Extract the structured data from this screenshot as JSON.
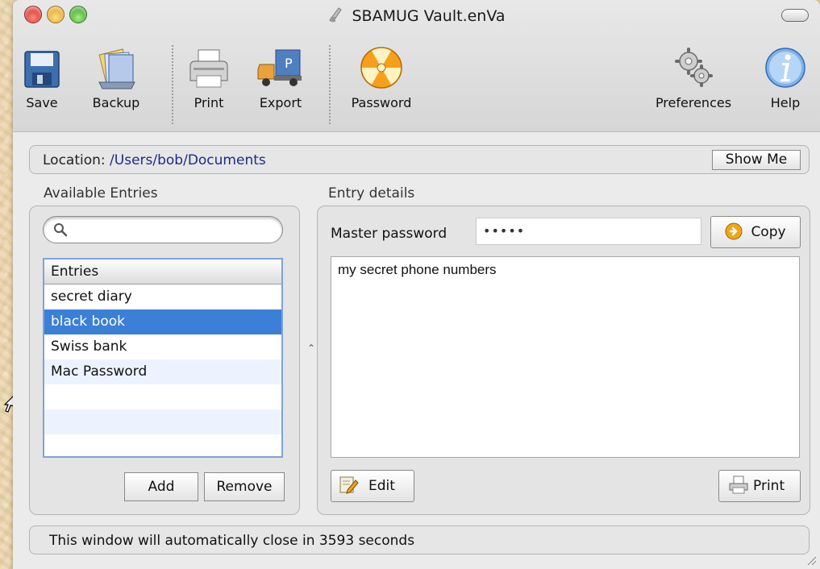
{
  "window": {
    "title": "SBAMUG Vault.enVa"
  },
  "toolbar": {
    "items": [
      {
        "label": "Save",
        "icon": "floppy-disk-icon"
      },
      {
        "label": "Backup",
        "icon": "backup-icon"
      },
      {
        "label": "Print",
        "icon": "printer-icon"
      },
      {
        "label": "Export",
        "icon": "export-truck-icon"
      },
      {
        "label": "Password",
        "icon": "radiation-password-icon"
      },
      {
        "label": "Preferences",
        "icon": "gears-icon"
      },
      {
        "label": "Help",
        "icon": "info-help-icon"
      }
    ]
  },
  "location": {
    "label": "Location:",
    "path": "/Users/bob/Documents",
    "show_me": "Show Me"
  },
  "entries_panel": {
    "title": "Available Entries",
    "search_placeholder": "",
    "column_header": "Entries",
    "entries": [
      "secret diary",
      "black book",
      "Swiss bank",
      "Mac Password"
    ],
    "selected": "black book",
    "add_label": "Add",
    "remove_label": "Remove"
  },
  "details_panel": {
    "title": "Entry details",
    "master_password_label": "Master password",
    "master_password_value": "•••••",
    "copy_label": "Copy",
    "content": "my secret phone numbers",
    "edit_label": "Edit",
    "print_label": "Print"
  },
  "status": {
    "message": "This window will automatically close in 3593 seconds"
  },
  "colors": {
    "selection": "#3b7fd6",
    "location_path": "#1c2a8a",
    "desktop": "#e9d7ae"
  }
}
